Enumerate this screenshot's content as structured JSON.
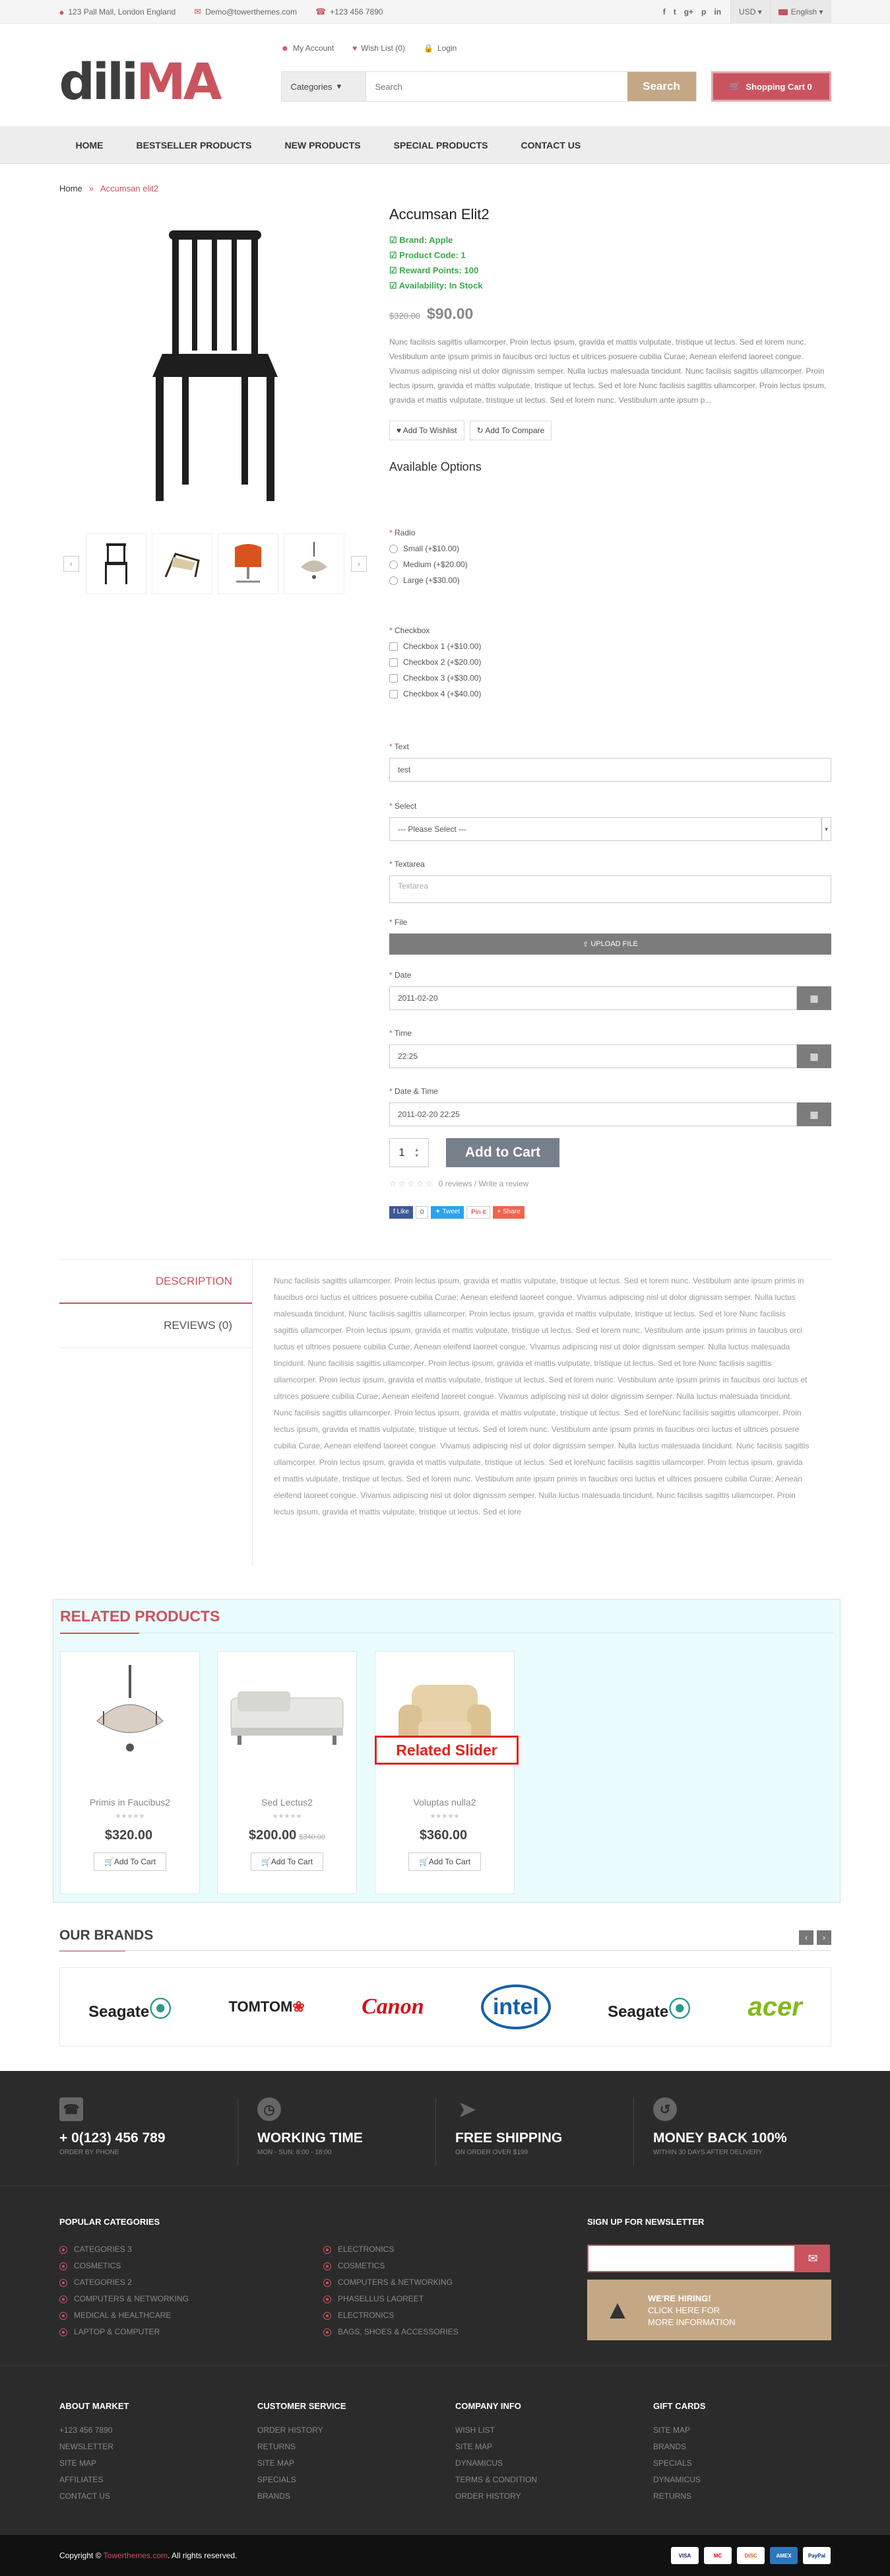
{
  "topbar": {
    "address": "123 Pall Mall, London England",
    "email": "Demo@towerthemes.com",
    "phone": "+123 456 7890",
    "social": [
      "f",
      "t",
      "g+",
      "p",
      "in"
    ],
    "currency": "USD",
    "language": "English"
  },
  "header": {
    "logo_dark": "dili",
    "logo_accent": "MA",
    "account": "My Account",
    "wishlist": "Wish List (0)",
    "login": "Login",
    "search_category": "Categories",
    "search_placeholder": "Search",
    "search_button": "Search",
    "cart": "Shopping Cart 0"
  },
  "nav": [
    "Home",
    "Bestseller Products",
    "New Products",
    "Special Products",
    "Contact Us"
  ],
  "breadcrumb": {
    "home": "Home",
    "current": "Accumsan elit2"
  },
  "product": {
    "title": "Accumsan Elit2",
    "brand": "Brand: Apple",
    "code": "Product Code: 1",
    "reward": "Reward Points: 100",
    "availability": "Availability: In Stock",
    "old_price": "$320.00",
    "price": "$90.00",
    "description": "Nunc facilisis sagittis ullamcorper. Proin lectus ipsum, gravida et mattis vulputate, tristique ut lectus. Sed et lorem nunc. Vestibulum ante ipsum primis in faucibus orci luctus et ultrices posuere cubilia Curae; Aenean eleifend laoreet congue. Vivamus adipiscing nisl ut dolor dignissim semper. Nulla luctus malesuada tincidunt. Nunc facilisis sagittis ullamcorper. Proin lectus ipsum, gravida et mattis vulputate, tristique ut lectus. Sed et lore Nunc facilisis sagittis ullamcorper. Proin lectus ipsum, gravida et mattis vulputate, tristique ut lectus. Sed et lorem nunc. Vestibulum ante ipsum p...",
    "wishlist_btn": "Add To Wishlist",
    "compare_btn": "Add To Compare",
    "available_options": "Available Options"
  },
  "options": {
    "radio_label": "Radio",
    "radios": [
      "Small (+$10.00)",
      "Medium (+$20.00)",
      "Large (+$30.00)"
    ],
    "checkbox_label": "Checkbox",
    "checkboxes": [
      "Checkbox 1 (+$10.00)",
      "Checkbox 2 (+$20.00)",
      "Checkbox 3 (+$30.00)",
      "Checkbox 4 (+$40.00)"
    ],
    "text_label": "Text",
    "text_value": "test",
    "select_label": "Select",
    "select_value": "--- Please Select ---",
    "textarea_label": "Textarea",
    "textarea_placeholder": "Textarea",
    "file_label": "File",
    "upload_btn": "UPLOAD FILE",
    "date_label": "Date",
    "date_value": "2011-02-20",
    "time_label": "Time",
    "time_value": "22:25",
    "datetime_label": "Date & Time",
    "datetime_value": "2011-02-20 22:25"
  },
  "cart": {
    "qty": "1",
    "add": "Add to Cart",
    "reviews": "0 reviews / Write a review",
    "rating": 0
  },
  "share": {
    "like": "Like",
    "like_count": "0",
    "tweet": "Tweet",
    "pin": "Pin it",
    "share": "Share"
  },
  "tabs": {
    "description": "DESCRIPTION",
    "reviews": "REVIEWS (0)",
    "content": "Nunc facilisis sagittis ullamcorper. Proin lectus ipsum, gravida et mattis vulputate, tristique ut lectus. Sed et lorem nunc. Vestibulum ante ipsum primis in faucibus orci luctus et ultrices posuere cubilia Curae; Aenean eleifend laoreet congue. Vivamus adipiscing nisl ut dolor dignissim semper. Nulla luctus malesuada tincidunt. Nunc facilisis sagittis ullamcorper. Proin lectus ipsum, gravida et mattis vulputate, tristique ut lectus. Sed et lore Nunc facilisis sagittis ullamcorper. Proin lectus ipsum, gravida et mattis vulputate, tristique ut lectus. Sed et lorem nunc. Vestibulum ante ipsum primis in faucibus orci luctus et ultrices posuere cubilia Curae; Aenean eleifend laoreet congue. Vivamus adipiscing nisl ut dolor dignissim semper. Nulla luctus malesuada tincidunt. Nunc facilisis sagittis ullamcorper. Proin lectus ipsum, gravida et mattis vulputate, tristique ut lectus. Sed et lore Nunc facilisis sagittis ullamcorper. Proin lectus ipsum, gravida et mattis vulputate, tristique ut lectus. Sed et lorem nunc. Vestibulum ante ipsum primis in faucibus orci luctus et ultrices posuere cubilia Curae; Aenean eleifend laoreet congue. Vivamus adipiscing nisl ut dolor dignissim semper. Nulla luctus malesuada tincidunt. Nunc facilisis sagittis ullamcorper. Proin lectus ipsum, gravida et mattis vulputate, tristique ut lectus. Sed et loreNunc facilisis sagittis ullamcorper. Proin lectus ipsum, gravida et mattis vulputate, tristique ut lectus. Sed et lorem nunc. Vestibulum ante ipsum primis in faucibus orci luctus et ultrices posuere cubilia Curae; Aenean eleifend laoreet congue. Vivamus adipiscing nisl ut dolor dignissim semper. Nulla luctus malesuada tincidunt. Nunc facilisis sagittis ullamcorper. Proin lectus ipsum, gravida et mattis vulputate, tristique ut lectus. Sed et loreNunc facilisis sagittis ullamcorper. Proin lectus ipsum, gravida et mattis vulputate, tristique ut lectus. Sed et lorem nunc. Vestibulum ante ipsum primis in faucibus orci luctus et ultrices posuere cubilia Curae; Aenean eleifend laoreet congue. Vivamus adipiscing nisl ut dolor dignissim semper. Nulla luctus malesuada tincidunt. Nunc facilisis sagittis ullamcorper. Proin lectus ipsum, gravida et mattis vulputate, tristique ut lectus. Sed et lore"
  },
  "related": {
    "title": "RELATED PRODUCTS",
    "overlay": "Related Slider",
    "add_btn": "Add To Cart",
    "items": [
      {
        "name": "Primis in Faucibus2",
        "price": "$320.00",
        "old": ""
      },
      {
        "name": "Sed Lectus2",
        "price": "$200.00",
        "old": "$340.00"
      },
      {
        "name": "Voluptas nulla2",
        "price": "$360.00",
        "old": ""
      }
    ]
  },
  "brands": {
    "title": "OUR BRANDS",
    "items": [
      "Seagate",
      "TOMTOM",
      "Canon",
      "intel",
      "Seagate",
      "acer"
    ]
  },
  "features": [
    {
      "title": "+ 0(123) 456 789",
      "sub": "ORDER BY PHONE"
    },
    {
      "title": "WORKING TIME",
      "sub": "MON - SUN: 8:00 - 18:00"
    },
    {
      "title": "FREE SHIPPING",
      "sub": "ON ORDER OVER $199"
    },
    {
      "title": "MONEY BACK 100%",
      "sub": "WITHIN 30 DAYS AFTER DELIVERY"
    }
  ],
  "footer": {
    "popular_title": "POPULAR CATEGORIES",
    "popular_left": [
      "CATEGORIES 3",
      "COSMETICS",
      "CATEGORIES 2",
      "COMPUTERS & NETWORKING",
      "MEDICAL & HEALTHCARE",
      "LAPTOP & COMPUTER"
    ],
    "popular_right": [
      "ELECTRONICS",
      "COSMETICS",
      "COMPUTERS & NETWORKING",
      "PHASELLUS LAOREET",
      "ELECTRONICS",
      "BAGS, SHOES & ACCESSORIES"
    ],
    "newsletter_title": "SIGN UP FOR NEWSLETTER",
    "hiring_title": "WE'RE HIRING!",
    "hiring_text": "CLICK HERE FOR MORE INFORMATION",
    "cols": [
      {
        "title": "ABOUT MARKET",
        "items": [
          "+123 456 7890",
          "NEWSLETTER",
          "SITE MAP",
          "AFFILIATES",
          "CONTACT US"
        ]
      },
      {
        "title": "CUSTOMER SERVICE",
        "items": [
          "ORDER HISTORY",
          "RETURNS",
          "SITE MAP",
          "SPECIALS",
          "BRANDS"
        ]
      },
      {
        "title": "COMPANY INFO",
        "items": [
          "WISH LIST",
          "SITE MAP",
          "DYNAMICUS",
          "TERMS & CONDITION",
          "ORDER HISTORY"
        ]
      },
      {
        "title": "GIFT CARDS",
        "items": [
          "SITE MAP",
          "BRANDS",
          "SPECIALS",
          "DYNAMICUS",
          "RETURNS"
        ]
      }
    ],
    "copyright_prefix": "Copyright ©",
    "copyright_link": "Towerthemes.com",
    "copyright_suffix": ". All rights reserved.",
    "payments": [
      "VISA",
      "MC",
      "DISC",
      "AMEX",
      "PayPal"
    ]
  },
  "colors": {
    "accent": "#c9545f",
    "tan": "#c4a886",
    "green": "#3aa74c",
    "related_bg": "#eafcfd",
    "footer_bg": "#2b2b2b"
  }
}
